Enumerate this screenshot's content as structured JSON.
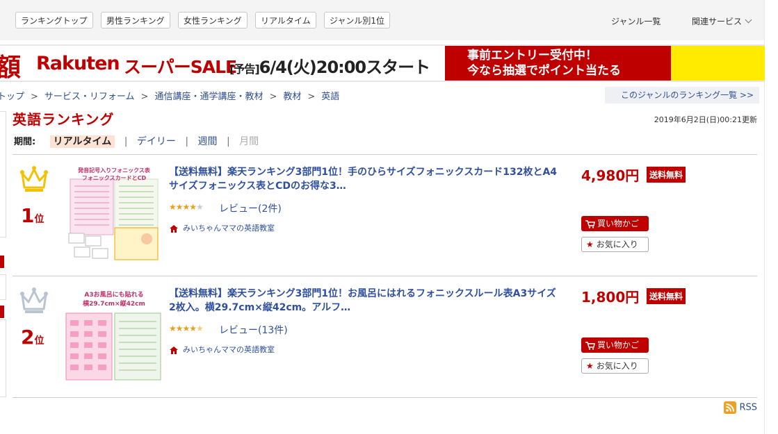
{
  "nav": {
    "buttons": [
      "ランキングトップ",
      "男性ランキング",
      "女性ランキング",
      "リアルタイム",
      "ジャンル別1位"
    ],
    "genre_list": "ジャンル一覧",
    "related": "関連サービス"
  },
  "banner": {
    "kanji": "額",
    "logo": "Rakuten",
    "sale": "スーパーSALE",
    "notice_bracket": "[予告]",
    "notice": "6/4(火)20:00スタート",
    "promo_line1": "事前エントリー受付中！",
    "promo_line2": "今なら抽選でポイント当たる"
  },
  "breadcrumb": [
    "トップ",
    "サービス・リフォーム",
    "通信講座・通学講座・教材",
    "教材",
    "英語"
  ],
  "breadcrumb_sep": ">",
  "genre_ranking_link": "このジャンルのランキング一覧 >>",
  "page_title": "英語ランキング",
  "updated": "2019年6月2日(日)00:21更新",
  "period": {
    "label": "期間:",
    "tabs": [
      "リアルタイム",
      "デイリー",
      "週間",
      "月間"
    ],
    "sep": "|"
  },
  "items": [
    {
      "rank_num": "1",
      "rank_suffix": "位",
      "title": "【送料無料】楽天ランキング3部門1位！手のひらサイズフォニックスカード132枚とA4サイズフォニックス表とCDのお得な3…",
      "rating": 4,
      "review": "レビュー(2件)",
      "shop": "みいちゃんママの英語教室",
      "price": "4,980円",
      "shipping": "送料無料",
      "cart": "買い物かご",
      "fav": "お気に入り",
      "thumb_caption1": "発音記号入りフォニックス表",
      "thumb_caption2": "フォニックスカードとCD"
    },
    {
      "rank_num": "2",
      "rank_suffix": "位",
      "title": "【送料無料】楽天ランキング3部門1位！お風呂にはれるフォニックスルール表A3サイズ2枚入。横29.7cm×縦42cm。アルフ…",
      "rating": 4.5,
      "review": "レビュー(13件)",
      "shop": "みいちゃんママの英語教室",
      "price": "1,800円",
      "shipping": "送料無料",
      "cart": "買い物かご",
      "fav": "お気に入り",
      "thumb_caption1": "A3お風呂にも貼れる",
      "thumb_caption2": "横29.7cm×縦42cm"
    }
  ],
  "rss": "RSS",
  "colors": {
    "accent": "#bf0000",
    "link": "#2f4f9f",
    "gold": "#f2c200",
    "silver": "#b8c4d0"
  },
  "icons": [
    "crown-gold-icon",
    "crown-silver-icon",
    "shop-house-icon",
    "cart-icon",
    "star-icon",
    "rss-icon",
    "chevron-down-icon"
  ]
}
